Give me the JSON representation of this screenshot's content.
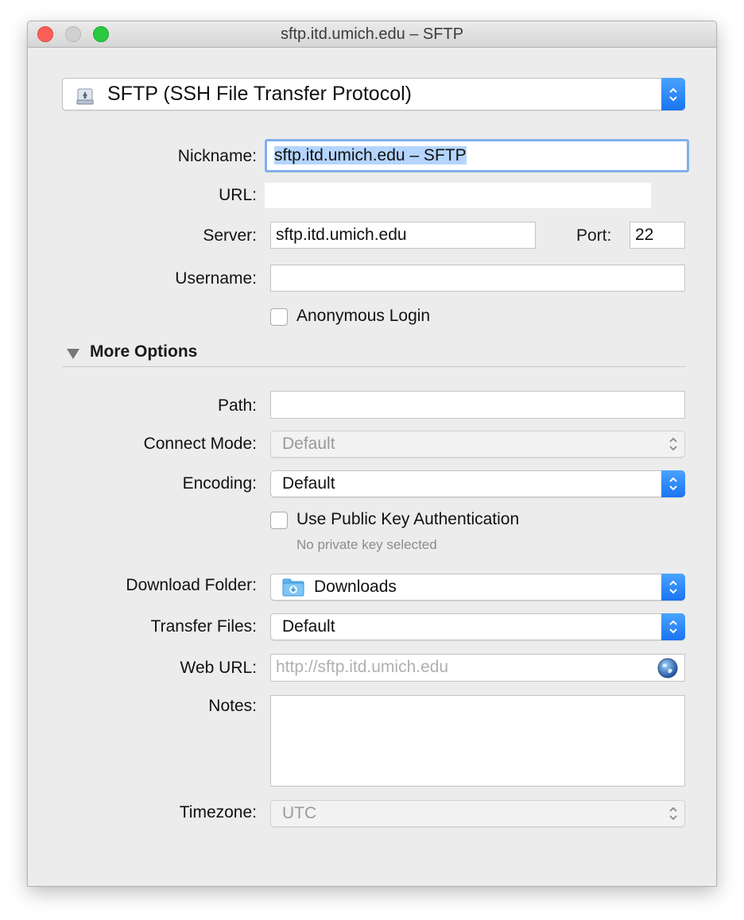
{
  "window": {
    "title": "sftp.itd.umich.edu – SFTP"
  },
  "protocol": {
    "selected": "SFTP (SSH File Transfer Protocol)"
  },
  "form": {
    "nickname": {
      "label": "Nickname:",
      "value": "sftp.itd.umich.edu – SFTP"
    },
    "url": {
      "label": "URL:",
      "value": ""
    },
    "server": {
      "label": "Server:",
      "value": "sftp.itd.umich.edu"
    },
    "port": {
      "label": "Port:",
      "value": "22"
    },
    "username": {
      "label": "Username:",
      "value": ""
    },
    "anonymous": {
      "label": "Anonymous Login",
      "checked": false
    }
  },
  "more_options": {
    "title": "More Options",
    "expanded": true,
    "path": {
      "label": "Path:",
      "value": ""
    },
    "connect_mode": {
      "label": "Connect Mode:",
      "value": "Default",
      "enabled": false
    },
    "encoding": {
      "label": "Encoding:",
      "value": "Default"
    },
    "public_key": {
      "label": "Use Public Key Authentication",
      "checked": false,
      "hint": "No private key selected"
    },
    "download_folder": {
      "label": "Download Folder:",
      "value": "Downloads"
    },
    "transfer_files": {
      "label": "Transfer Files:",
      "value": "Default"
    },
    "web_url": {
      "label": "Web URL:",
      "placeholder": "http://sftp.itd.umich.edu"
    },
    "notes": {
      "label": "Notes:",
      "value": ""
    },
    "timezone": {
      "label": "Timezone:",
      "value": "UTC",
      "enabled": false
    }
  },
  "colors": {
    "accent": "#1a74f0",
    "focus_ring": "#7fb0ea",
    "selection": "#b4d5fe"
  },
  "icons": {
    "protocol": "drive-icon",
    "folder": "downloads-folder-icon",
    "web": "globe-icon"
  }
}
